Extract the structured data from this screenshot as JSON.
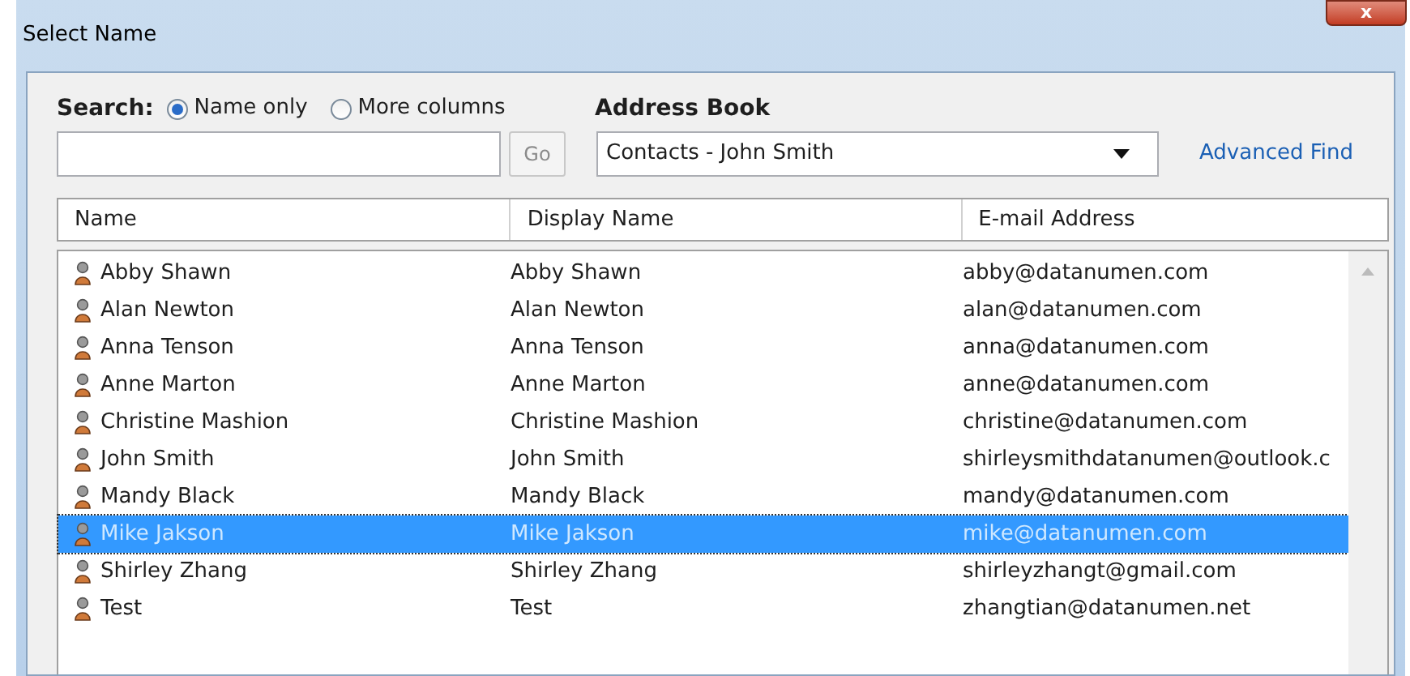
{
  "window": {
    "title": "Select Name",
    "close": "x"
  },
  "search": {
    "label": "Search:",
    "options": [
      {
        "label": "Name only",
        "selected": true
      },
      {
        "label": "More columns",
        "selected": false
      }
    ],
    "button": "Go"
  },
  "address_book": {
    "label": "Address Book",
    "value": "Contacts - John Smith",
    "link": "Advanced Find"
  },
  "table": {
    "columns": [
      "Name",
      "Display Name",
      "E-mail Address"
    ],
    "rows": [
      {
        "name": "Abby Shawn",
        "display_name": "Abby Shawn",
        "email": "abby@datanumen.com",
        "selected": false
      },
      {
        "name": "Alan Newton",
        "display_name": "Alan Newton",
        "email": "alan@datanumen.com",
        "selected": false
      },
      {
        "name": "Anna Tenson",
        "display_name": "Anna Tenson",
        "email": "anna@datanumen.com",
        "selected": false
      },
      {
        "name": "Anne Marton",
        "display_name": "Anne Marton",
        "email": "anne@datanumen.com",
        "selected": false
      },
      {
        "name": "Christine Mashion",
        "display_name": "Christine Mashion",
        "email": "christine@datanumen.com",
        "selected": false
      },
      {
        "name": "John Smith",
        "display_name": "John Smith",
        "email": "shirleysmithdatanumen@outlook.c",
        "selected": false
      },
      {
        "name": "Mandy Black",
        "display_name": "Mandy Black",
        "email": "mandy@datanumen.com",
        "selected": false
      },
      {
        "name": "Mike Jakson",
        "display_name": "Mike Jakson",
        "email": "mike@datanumen.com",
        "selected": true
      },
      {
        "name": "Shirley Zhang",
        "display_name": "Shirley Zhang",
        "email": "shirleyzhangt@gmail.com",
        "selected": false
      },
      {
        "name": "Test",
        "display_name": "Test",
        "email": "zhangtian@datanumen.net",
        "selected": false
      }
    ]
  }
}
